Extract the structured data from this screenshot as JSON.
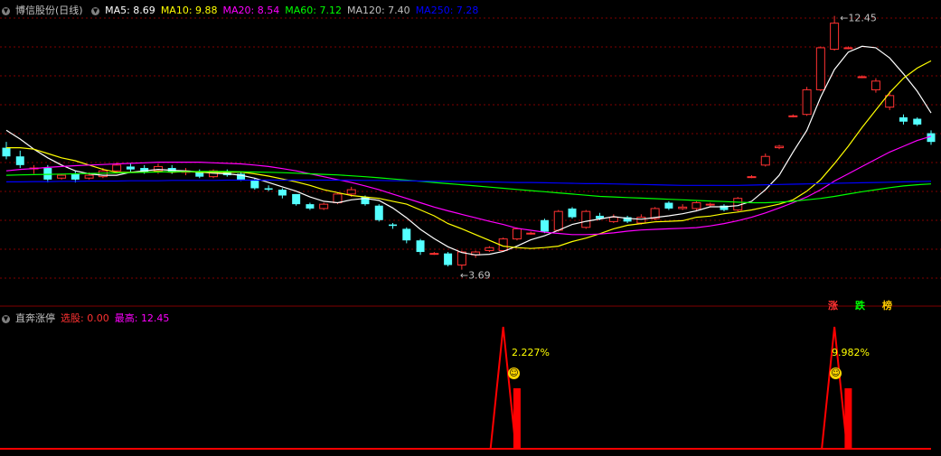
{
  "header": {
    "stock_name": "博信股份",
    "period": "(日线)",
    "ma": [
      {
        "label": "MA5:",
        "value": "8.69",
        "color": "#ffffff"
      },
      {
        "label": "MA10:",
        "value": "9.88",
        "color": "#ffff00"
      },
      {
        "label": "MA20:",
        "value": "8.54",
        "color": "#ff00ff"
      },
      {
        "label": "MA60:",
        "value": "7.12",
        "color": "#00ff00"
      },
      {
        "label": "MA120:",
        "value": "7.40",
        "color": "#c0c0c0"
      },
      {
        "label": "MA250:",
        "value": "7.28",
        "color": "#0000ff"
      }
    ]
  },
  "annotations": {
    "high_label": "12.45",
    "low_label": "3.69",
    "tag_up": "涨",
    "tag_down": "跌",
    "tag_list": "榜"
  },
  "indicator": {
    "name": "直奔涨停",
    "select_label": "选股:",
    "select_value": "0.00",
    "max_label": "最高:",
    "max_value": "12.45",
    "signal1_pct": "2.227%",
    "signal2_pct": "9.982%",
    "smile_glyph": "☺"
  },
  "colors": {
    "up": "#ff3232",
    "down": "#54ffff",
    "grid": "#800000",
    "ma5": "#ffffff",
    "ma10": "#ffff00",
    "ma20": "#ff00ff",
    "ma60": "#00ff00",
    "ma250": "#0000ff",
    "indicator": "#ff0000"
  },
  "chart_data": {
    "type": "candlestick",
    "price_range": [
      2.4,
      13.0
    ],
    "high": 12.45,
    "low": 3.69,
    "candles": [
      [
        7.9,
        7.6,
        8.1,
        7.5
      ],
      [
        7.6,
        7.3,
        7.8,
        7.2
      ],
      [
        7.2,
        7.2,
        7.3,
        7.0
      ],
      [
        7.2,
        6.8,
        7.3,
        6.7
      ],
      [
        6.85,
        6.95,
        7.0,
        6.8
      ],
      [
        7.0,
        6.8,
        7.1,
        6.7
      ],
      [
        6.85,
        6.95,
        7.05,
        6.8
      ],
      [
        6.9,
        7.1,
        7.2,
        6.85
      ],
      [
        7.1,
        7.3,
        7.4,
        7.0
      ],
      [
        7.25,
        7.15,
        7.35,
        7.05
      ],
      [
        7.2,
        7.05,
        7.3,
        7.0
      ],
      [
        7.1,
        7.25,
        7.35,
        7.0
      ],
      [
        7.2,
        7.05,
        7.3,
        7.0
      ],
      [
        7.05,
        7.1,
        7.2,
        6.95
      ],
      [
        7.05,
        6.9,
        7.15,
        6.85
      ],
      [
        6.9,
        7.1,
        7.15,
        6.85
      ],
      [
        7.05,
        6.95,
        7.15,
        6.9
      ],
      [
        7.0,
        6.8,
        7.05,
        6.75
      ],
      [
        6.8,
        6.5,
        6.85,
        6.45
      ],
      [
        6.5,
        6.45,
        6.6,
        6.4
      ],
      [
        6.45,
        6.25,
        6.5,
        6.15
      ],
      [
        6.3,
        5.95,
        6.3,
        5.9
      ],
      [
        5.95,
        5.8,
        6.0,
        5.75
      ],
      [
        5.8,
        5.95,
        6.0,
        5.75
      ],
      [
        6.0,
        6.3,
        6.35,
        5.95
      ],
      [
        6.3,
        6.45,
        6.55,
        6.2
      ],
      [
        6.2,
        5.95,
        6.25,
        5.9
      ],
      [
        5.9,
        5.4,
        5.95,
        5.35
      ],
      [
        5.25,
        5.2,
        5.3,
        5.1
      ],
      [
        5.1,
        4.7,
        5.15,
        4.6
      ],
      [
        4.7,
        4.3,
        4.75,
        4.2
      ],
      [
        4.25,
        4.25,
        4.3,
        4.2
      ],
      [
        4.25,
        3.85,
        4.3,
        3.8
      ],
      [
        3.85,
        4.3,
        4.35,
        3.69
      ],
      [
        4.2,
        4.3,
        4.35,
        4.1
      ],
      [
        4.35,
        4.45,
        4.5,
        4.3
      ],
      [
        4.35,
        4.75,
        4.8,
        4.3
      ],
      [
        4.75,
        5.1,
        5.15,
        4.7
      ],
      [
        4.95,
        4.95,
        5.0,
        4.9
      ],
      [
        5.4,
        5.0,
        5.45,
        4.95
      ],
      [
        5.05,
        5.7,
        5.75,
        5.0
      ],
      [
        5.8,
        5.5,
        5.85,
        5.45
      ],
      [
        5.15,
        5.7,
        5.75,
        5.1
      ],
      [
        5.55,
        5.45,
        5.65,
        5.4
      ],
      [
        5.35,
        5.5,
        5.6,
        5.3
      ],
      [
        5.5,
        5.35,
        5.55,
        5.3
      ],
      [
        5.3,
        5.5,
        5.6,
        5.25
      ],
      [
        5.45,
        5.8,
        5.85,
        5.4
      ],
      [
        6.0,
        5.8,
        6.05,
        5.75
      ],
      [
        5.8,
        5.85,
        5.95,
        5.75
      ],
      [
        5.8,
        6.0,
        6.05,
        5.7
      ],
      [
        5.95,
        5.95,
        6.0,
        5.85
      ],
      [
        5.9,
        5.75,
        5.95,
        5.7
      ],
      [
        5.75,
        6.15,
        6.2,
        5.7
      ],
      [
        6.9,
        6.9,
        6.95,
        6.85
      ],
      [
        7.3,
        7.6,
        7.7,
        7.25
      ],
      [
        7.9,
        7.95,
        8.0,
        7.85
      ],
      [
        9.0,
        9.0,
        9.05,
        8.95
      ],
      [
        9.05,
        9.9,
        10.0,
        9.0
      ],
      [
        9.9,
        11.35,
        11.4,
        9.85
      ],
      [
        11.3,
        12.2,
        12.45,
        11.25
      ],
      [
        11.35,
        11.35,
        11.4,
        11.3
      ],
      [
        10.35,
        10.35,
        10.4,
        10.3
      ],
      [
        9.9,
        10.2,
        10.3,
        9.8
      ],
      [
        9.3,
        9.7,
        9.85,
        9.2
      ],
      [
        8.95,
        8.8,
        9.05,
        8.7
      ],
      [
        8.9,
        8.7,
        8.95,
        8.65
      ],
      [
        8.4,
        8.1,
        8.5,
        8.0
      ]
    ],
    "series": [
      {
        "name": "MA5",
        "values": [
          8.5,
          8.2,
          7.85,
          7.55,
          7.3,
          7.1,
          7.0,
          6.95,
          6.95,
          7.05,
          7.1,
          7.15,
          7.12,
          7.1,
          7.06,
          7.02,
          7.0,
          6.95,
          6.85,
          6.7,
          6.55,
          6.4,
          6.2,
          6.05,
          6.0,
          6.1,
          6.15,
          6.08,
          5.82,
          5.48,
          5.08,
          4.76,
          4.48,
          4.28,
          4.2,
          4.22,
          4.32,
          4.5,
          4.72,
          4.86,
          5.05,
          5.25,
          5.36,
          5.44,
          5.52,
          5.46,
          5.43,
          5.49,
          5.55,
          5.62,
          5.72,
          5.86,
          5.86,
          5.9,
          6.05,
          6.45,
          6.95,
          7.75,
          8.5,
          9.65,
          10.6,
          11.2,
          11.4,
          11.35,
          11.0,
          10.45,
          9.85,
          9.1
        ]
      },
      {
        "name": "MA10",
        "values": [
          7.9,
          7.9,
          7.85,
          7.7,
          7.55,
          7.45,
          7.3,
          7.15,
          7.05,
          7.05,
          7.05,
          7.08,
          7.05,
          7.08,
          7.05,
          7.05,
          7.05,
          7.06,
          7.0,
          6.92,
          6.82,
          6.72,
          6.6,
          6.45,
          6.35,
          6.25,
          6.2,
          6.15,
          6.05,
          5.95,
          5.75,
          5.55,
          5.28,
          5.1,
          4.9,
          4.7,
          4.5,
          4.45,
          4.42,
          4.45,
          4.5,
          4.66,
          4.78,
          4.93,
          5.1,
          5.22,
          5.28,
          5.34,
          5.36,
          5.38,
          5.5,
          5.54,
          5.62,
          5.68,
          5.75,
          5.85,
          5.95,
          6.1,
          6.4,
          6.8,
          7.35,
          7.95,
          8.6,
          9.2,
          9.8,
          10.3,
          10.65,
          10.9
        ]
      },
      {
        "name": "MA20",
        "values": [
          7.1,
          7.15,
          7.18,
          7.22,
          7.25,
          7.28,
          7.3,
          7.32,
          7.34,
          7.36,
          7.38,
          7.4,
          7.4,
          7.4,
          7.4,
          7.38,
          7.36,
          7.34,
          7.3,
          7.25,
          7.18,
          7.1,
          7.0,
          6.9,
          6.8,
          6.7,
          6.58,
          6.45,
          6.3,
          6.15,
          6.0,
          5.85,
          5.72,
          5.6,
          5.48,
          5.36,
          5.25,
          5.12,
          5.05,
          4.98,
          4.94,
          4.9,
          4.9,
          4.92,
          4.96,
          5.02,
          5.06,
          5.08,
          5.1,
          5.12,
          5.14,
          5.2,
          5.28,
          5.38,
          5.5,
          5.65,
          5.82,
          6.0,
          6.2,
          6.45,
          6.75,
          7.0,
          7.25,
          7.5,
          7.75,
          7.95,
          8.15,
          8.3
        ]
      },
      {
        "name": "MA60",
        "values": [
          6.95,
          6.96,
          6.97,
          6.98,
          6.99,
          7.0,
          7.01,
          7.02,
          7.03,
          7.04,
          7.05,
          7.06,
          7.07,
          7.07,
          7.08,
          7.08,
          7.08,
          7.07,
          7.06,
          7.05,
          7.04,
          7.02,
          7.0,
          6.98,
          6.96,
          6.93,
          6.9,
          6.86,
          6.82,
          6.78,
          6.74,
          6.7,
          6.66,
          6.62,
          6.58,
          6.54,
          6.5,
          6.46,
          6.42,
          6.38,
          6.34,
          6.3,
          6.26,
          6.22,
          6.2,
          6.18,
          6.16,
          6.14,
          6.12,
          6.1,
          6.08,
          6.06,
          6.04,
          6.02,
          6.0,
          6.0,
          6.02,
          6.05,
          6.1,
          6.15,
          6.22,
          6.3,
          6.38,
          6.45,
          6.52,
          6.58,
          6.62,
          6.65
        ]
      },
      {
        "name": "MA250",
        "values": [
          6.72,
          6.72,
          6.73,
          6.73,
          6.74,
          6.74,
          6.75,
          6.75,
          6.75,
          6.76,
          6.76,
          6.76,
          6.77,
          6.77,
          6.77,
          6.77,
          6.78,
          6.78,
          6.78,
          6.78,
          6.78,
          6.78,
          6.78,
          6.78,
          6.78,
          6.78,
          6.77,
          6.77,
          6.76,
          6.76,
          6.75,
          6.74,
          6.74,
          6.73,
          6.72,
          6.72,
          6.71,
          6.7,
          6.7,
          6.69,
          6.68,
          6.67,
          6.66,
          6.66,
          6.65,
          6.64,
          6.63,
          6.62,
          6.61,
          6.6,
          6.6,
          6.6,
          6.6,
          6.6,
          6.61,
          6.62,
          6.63,
          6.64,
          6.65,
          6.66,
          6.67,
          6.68,
          6.69,
          6.7,
          6.71,
          6.72,
          6.73,
          6.74
        ]
      }
    ],
    "indicator": {
      "signal_bars": [
        {
          "index": 37,
          "value": 2.227
        },
        {
          "index": 61,
          "value": 9.982
        }
      ]
    }
  }
}
